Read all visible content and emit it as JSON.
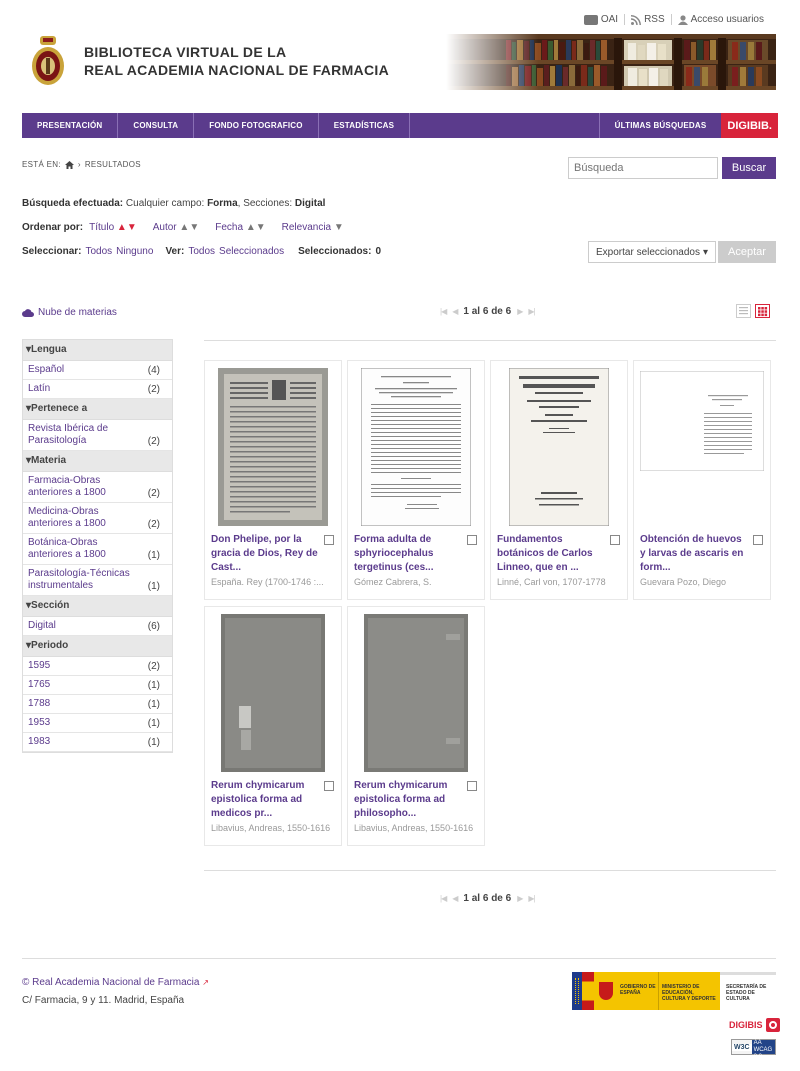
{
  "top_links": {
    "oai": "OAI",
    "rss": "RSS",
    "access": "Acceso usuarios"
  },
  "site": {
    "title_line1": "BIBLIOTECA VIRTUAL DE LA",
    "title_line2": "REAL ACADEMIA NACIONAL DE FARMACIA"
  },
  "nav": {
    "items": [
      "PRESENTACIÓN",
      "CONSULTA",
      "FONDO FOTOGRAFICO",
      "ESTADÍSTICAS"
    ],
    "recent": "ÚLTIMAS BÚSQUEDAS",
    "brand": "DIGIBIB."
  },
  "breadcrumb": {
    "prefix": "ESTÁ EN:",
    "current": "RESULTADOS"
  },
  "search": {
    "placeholder": "Búsqueda",
    "button": "Buscar"
  },
  "query": {
    "label": "Búsqueda efectuada:",
    "field_label": "Cualquier campo:",
    "field_value": "Forma",
    "sections_label": ", Secciones:",
    "sections_value": "Digital"
  },
  "sort": {
    "label": "Ordenar por:",
    "options": [
      "Título",
      "Autor",
      "Fecha",
      "Relevancia"
    ]
  },
  "select": {
    "label": "Seleccionar:",
    "all": "Todos",
    "none": "Ninguno",
    "view_label": "Ver:",
    "view_all": "Todos",
    "view_selected": "Seleccionados",
    "selected_label": "Seleccionados:",
    "selected_count": "0"
  },
  "export": {
    "value": "Exportar seleccionados",
    "accept": "Aceptar"
  },
  "cloud": "Nube de materias",
  "pager": {
    "text": "1 al 6 de 6"
  },
  "facets": [
    {
      "header": "Lengua",
      "items": [
        {
          "label": "Español",
          "count": "(4)"
        },
        {
          "label": "Latín",
          "count": "(2)"
        }
      ]
    },
    {
      "header": "Pertenece a",
      "items": [
        {
          "label": "Revista Ibérica de Parasitología",
          "count": "(2)"
        }
      ]
    },
    {
      "header": "Materia",
      "items": [
        {
          "label": "Farmacia-Obras anteriores a 1800",
          "count": "(2)"
        },
        {
          "label": "Medicina-Obras anteriores a 1800",
          "count": "(2)"
        },
        {
          "label": "Botánica-Obras anteriores a 1800",
          "count": "(1)"
        },
        {
          "label": "Parasitología-Técnicas instrumentales",
          "count": "(1)"
        }
      ]
    },
    {
      "header": "Sección",
      "items": [
        {
          "label": "Digital",
          "count": "(6)"
        }
      ]
    },
    {
      "header": "Periodo",
      "items": [
        {
          "label": "1595",
          "count": "(2)"
        },
        {
          "label": "1765",
          "count": "(1)"
        },
        {
          "label": "1788",
          "count": "(1)"
        },
        {
          "label": "1953",
          "count": "(1)"
        },
        {
          "label": "1983",
          "count": "(1)"
        }
      ]
    }
  ],
  "results": [
    {
      "title": "Don Phelipe, por la gracia de Dios, Rey de Cast...",
      "author": "España. Rey (1700-1746 :...",
      "thumb": "old-print"
    },
    {
      "title": "Forma adulta de sphyriocephalus tergetinus (ces...",
      "author": "Gómez Cabrera, S.",
      "thumb": "typed-page"
    },
    {
      "title": "Fundamentos botánicos de Carlos Linneo, que en ...",
      "author": "Linné, Carl von, 1707-1778",
      "thumb": "title-page"
    },
    {
      "title": "Obtención de huevos y larvas de ascaris en form...",
      "author": "Guevara Pozo, Diego",
      "thumb": "small-page"
    },
    {
      "title": "Rerum chymicarum epistolica forma ad medicos pr...",
      "author": "Libavius, Andreas, 1550-1616",
      "thumb": "vellum"
    },
    {
      "title": "Rerum chymicarum epistolica forma ad philosopho...",
      "author": "Libavius, Andreas, 1550-1616",
      "thumb": "vellum2"
    }
  ],
  "footer": {
    "copyright": "© Real Academia Nacional de Farmacia",
    "address": "C/ Farmacia, 9 y 11. Madrid, España",
    "gov1": "GOBIERNO DE ESPAÑA",
    "gov2": "MINISTERIO DE EDUCACIÓN, CULTURA Y DEPORTE",
    "gov3": "SECRETARÍA DE ESTADO DE CULTURA",
    "digibis": "DIGIBIS",
    "wai1": "WAI-AA",
    "wai2": "WCAG 2.0",
    "w3c": "W3C"
  }
}
